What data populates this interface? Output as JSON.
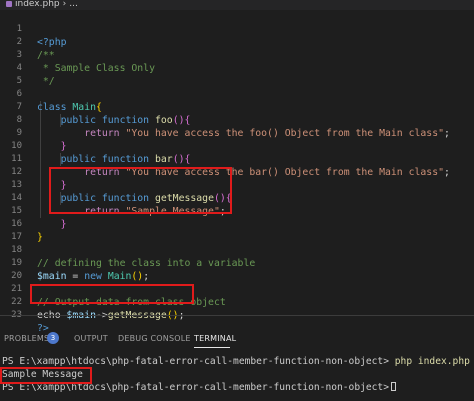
{
  "tab": {
    "filename": "index.php",
    "more": "..."
  },
  "code": {
    "line_numbers": [
      "1",
      "2",
      "3",
      "4",
      "5",
      "6",
      "7",
      "8",
      "9",
      "10",
      "11",
      "12",
      "13",
      "14",
      "15",
      "16",
      "17",
      "18",
      "19",
      "20",
      "21",
      "22",
      "23"
    ],
    "l1": "<?php",
    "l2": "/**",
    "l3": " * Sample Class Only",
    "l4": " */",
    "l6_kw": "class",
    "l6_name": "Main",
    "l6_brace": "{",
    "public": "public",
    "function": "function",
    "return": "return",
    "l7_fn": "foo",
    "l8_str": "\"You have access the foo() Object from the Main class\"",
    "l10_fn": "bar",
    "l11_str": "\"You have access the bar() Object from the Main class\"",
    "l13_fn": "getMessage",
    "l14_str": "\"Sample Message\"",
    "l18": "// defining the class into a variable",
    "l19_var": "$main",
    "l19_eq": " = ",
    "l19_new": "new",
    "l19_cls": "Main",
    "l21": "// Output data from class object",
    "l22_echo": "echo",
    "l22_var": "$main",
    "l22_arrow": "->",
    "l22_fn": "getMessage",
    "l23": "?>"
  },
  "panel": {
    "problems": "PROBLEMS",
    "problems_count": "3",
    "output": "OUTPUT",
    "debug_console": "DEBUG CONSOLE",
    "terminal": "TERMINAL"
  },
  "terminal": {
    "prompt": "PS E:\\xampp\\htdocs\\php-fatal-error-call-member-function-non-object>",
    "command": "php index.php",
    "output_line": "Sample Message"
  }
}
